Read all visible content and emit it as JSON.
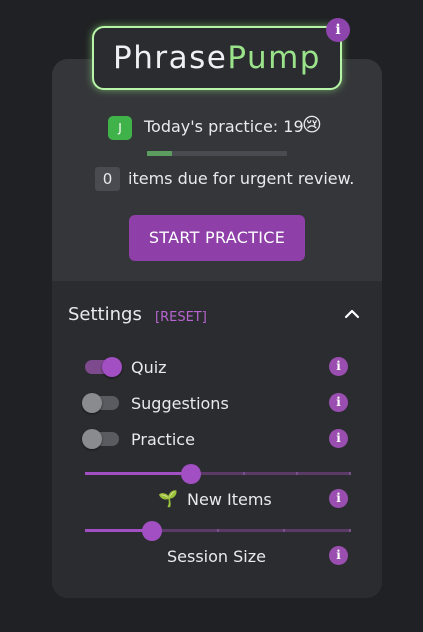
{
  "app": {
    "logo_part1": "Phrase",
    "logo_part2": "Pump",
    "info_glyph": "i"
  },
  "status": {
    "avatar_letter": "J",
    "today_label": "Today's practice: 19",
    "mood_emoji": "😢",
    "progress_fraction": 0.18,
    "due_count": "0",
    "due_text": "items due for urgent review.",
    "start_button": "START PRACTICE"
  },
  "settings": {
    "title": "Settings",
    "reset_label": "[RESET]",
    "toggles": [
      {
        "label": "Quiz",
        "on": true
      },
      {
        "label": "Suggestions",
        "on": false
      },
      {
        "label": "Practice",
        "on": false
      }
    ],
    "sliders": [
      {
        "label": "New Items",
        "emoji": "🌱",
        "fraction": 0.4
      },
      {
        "label": "Session Size",
        "emoji": "",
        "fraction": 0.25
      }
    ]
  },
  "colors": {
    "accent": "#8e3fa8",
    "logo_glow": "#b8f5a8",
    "avatar": "#3fb24a",
    "progress": "#5b9d5e"
  }
}
